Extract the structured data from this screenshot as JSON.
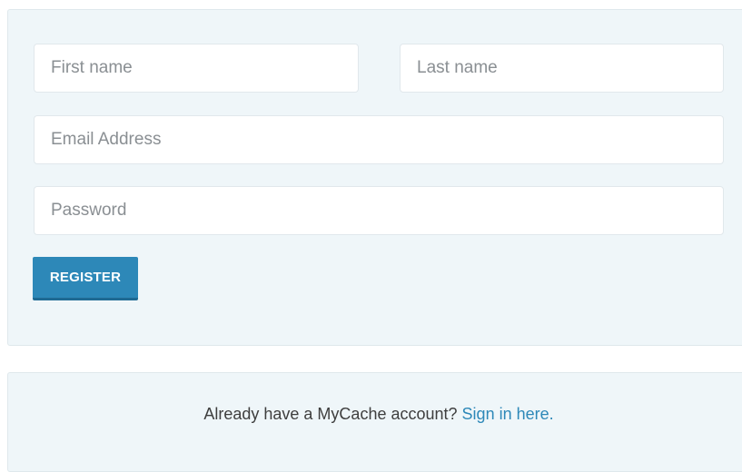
{
  "form": {
    "first_name_placeholder": "First name",
    "last_name_placeholder": "Last name",
    "email_placeholder": "Email Address",
    "password_placeholder": "Password",
    "register_label": "REGISTER"
  },
  "signin": {
    "prompt": "Already have a MyCache account?",
    "link_label": "Sign in here."
  },
  "colors": {
    "panel_background": "#eff6f9",
    "accent": "#2d88b8"
  }
}
